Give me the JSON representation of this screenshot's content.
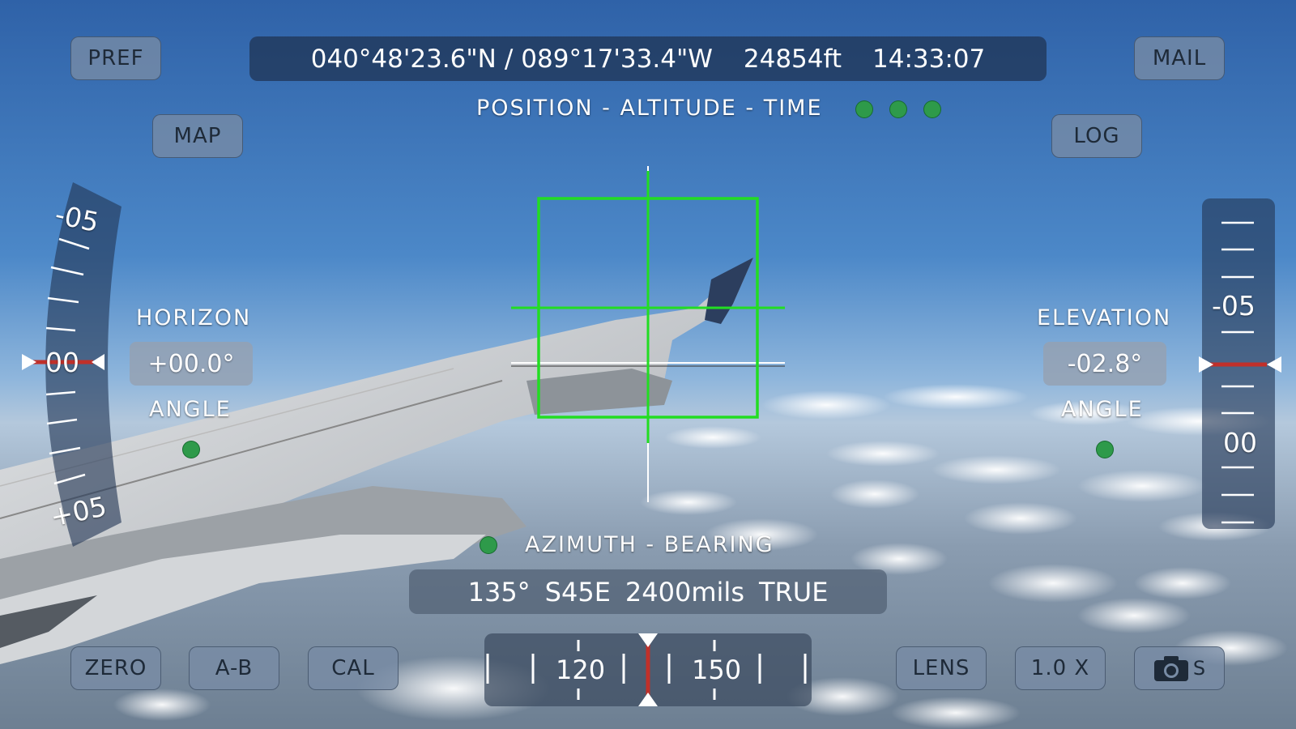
{
  "top_bar": {
    "latitude": "040°48'23.6\"N",
    "separator": "/",
    "longitude": "089°17'33.4\"W",
    "altitude": "24854ft",
    "time": "14:33:07",
    "caption": "POSITION - ALTITUDE - TIME"
  },
  "buttons": {
    "pref": "PREF",
    "mail": "MAIL",
    "map": "MAP",
    "log": "LOG",
    "zero": "ZERO",
    "ab": "A-B",
    "cal": "CAL",
    "lens": "LENS",
    "zoom": "1.0 X",
    "camera_mode": "S"
  },
  "horizon": {
    "title": "HORIZON",
    "value": "+00.0°",
    "subtitle": "ANGLE",
    "scale_labels": [
      "-05",
      "00",
      "+05"
    ]
  },
  "elevation": {
    "title": "ELEVATION",
    "value": "-02.8°",
    "subtitle": "ANGLE",
    "scale_labels": [
      "-05",
      "00"
    ]
  },
  "azimuth": {
    "title": "AZIMUTH - BEARING",
    "degrees": "135°",
    "quadrant": "S45E",
    "mils": "2400mils",
    "reference": "TRUE",
    "compass_labels": [
      "120",
      "150"
    ]
  },
  "icons": {
    "status_dots": "status-indicator-icon",
    "camera": "camera-icon"
  },
  "colors": {
    "reticle": "#22dd22",
    "status_green": "#2e9a4a",
    "indicator_red": "#c0302a"
  }
}
